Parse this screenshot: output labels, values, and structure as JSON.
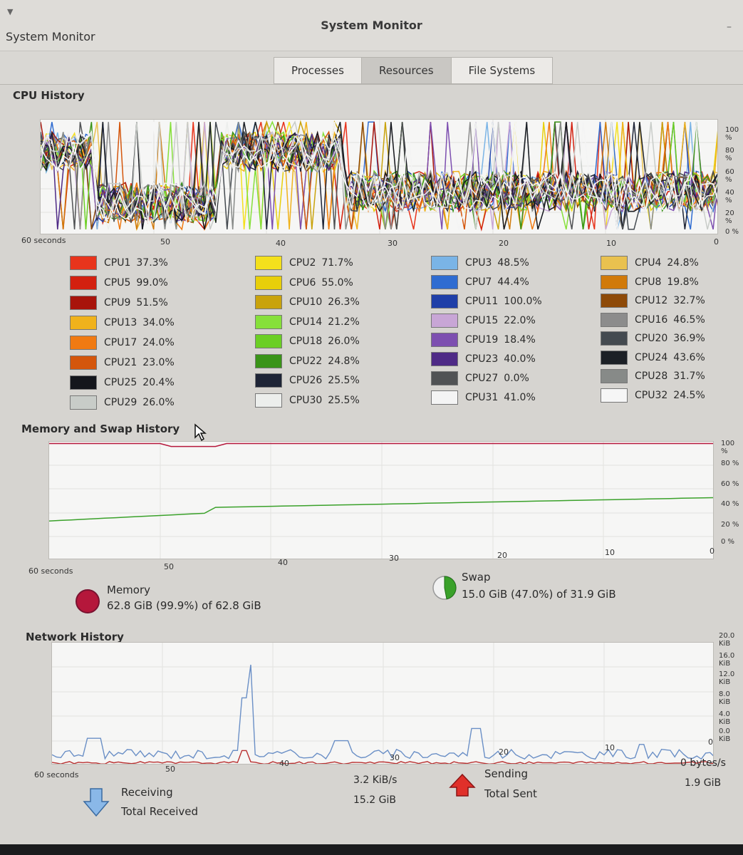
{
  "window": {
    "app_label": "System Monitor",
    "title": "System Monitor"
  },
  "tabs": [
    {
      "label": "Processes",
      "active": false
    },
    {
      "label": "Resources",
      "active": true
    },
    {
      "label": "File Systems",
      "active": false
    }
  ],
  "cpu": {
    "title": "CPU History",
    "y_ticks": [
      "100 %",
      "80 %",
      "60 %",
      "40 %",
      "20 %",
      "0 %"
    ],
    "x_ticks": [
      "60 seconds",
      "50",
      "40",
      "30",
      "20",
      "10",
      "0"
    ],
    "cores": [
      {
        "label": "CPU1",
        "value": "37.3%",
        "color": "#e8341c"
      },
      {
        "label": "CPU2",
        "value": "71.7%",
        "color": "#f4e01c"
      },
      {
        "label": "CPU3",
        "value": "48.5%",
        "color": "#7ab4e6"
      },
      {
        "label": "CPU4",
        "value": "24.8%",
        "color": "#e9c14f"
      },
      {
        "label": "CPU5",
        "value": "99.0%",
        "color": "#d3200f"
      },
      {
        "label": "CPU6",
        "value": "55.0%",
        "color": "#e8cf0a"
      },
      {
        "label": "CPU7",
        "value": "44.4%",
        "color": "#2f6cd1"
      },
      {
        "label": "CPU8",
        "value": "19.8%",
        "color": "#d17a0a"
      },
      {
        "label": "CPU9",
        "value": "51.5%",
        "color": "#a8140b"
      },
      {
        "label": "CPU10",
        "value": "26.3%",
        "color": "#c9a30c"
      },
      {
        "label": "CPU11",
        "value": "100.0%",
        "color": "#1f3fa8"
      },
      {
        "label": "CPU12",
        "value": "32.7%",
        "color": "#8e4a08"
      },
      {
        "label": "CPU13",
        "value": "34.0%",
        "color": "#f0b21c"
      },
      {
        "label": "CPU14",
        "value": "21.2%",
        "color": "#86e03a"
      },
      {
        "label": "CPU15",
        "value": "22.0%",
        "color": "#c8a6d6"
      },
      {
        "label": "CPU16",
        "value": "46.5%",
        "color": "#8c8c8c"
      },
      {
        "label": "CPU17",
        "value": "24.0%",
        "color": "#f07a12"
      },
      {
        "label": "CPU18",
        "value": "26.0%",
        "color": "#6bcf24"
      },
      {
        "label": "CPU19",
        "value": "18.4%",
        "color": "#7d4fb0"
      },
      {
        "label": "CPU20",
        "value": "36.9%",
        "color": "#444a50"
      },
      {
        "label": "CPU21",
        "value": "23.0%",
        "color": "#d4560c"
      },
      {
        "label": "CPU22",
        "value": "24.8%",
        "color": "#3a9418"
      },
      {
        "label": "CPU23",
        "value": "40.0%",
        "color": "#4e2a86"
      },
      {
        "label": "CPU24",
        "value": "43.6%",
        "color": "#1c2026"
      },
      {
        "label": "CPU25",
        "value": "20.4%",
        "color": "#14161c"
      },
      {
        "label": "CPU26",
        "value": "25.5%",
        "color": "#1e2436"
      },
      {
        "label": "CPU27",
        "value": "0.0%",
        "color": "#505254"
      },
      {
        "label": "CPU28",
        "value": "31.7%",
        "color": "#878a88"
      },
      {
        "label": "CPU29",
        "value": "26.0%",
        "color": "#c8ccc8"
      },
      {
        "label": "CPU30",
        "value": "25.5%",
        "color": "#eceeec"
      },
      {
        "label": "CPU31",
        "value": "41.0%",
        "color": "#f4f4f4"
      },
      {
        "label": "CPU32",
        "value": "24.5%",
        "color": "#f6f6f6"
      }
    ]
  },
  "memory": {
    "title": "Memory and Swap History",
    "y_ticks": [
      "100 %",
      "80 %",
      "60 %",
      "40 %",
      "20 %",
      "0 %"
    ],
    "x_ticks": [
      "60 seconds",
      "50",
      "40",
      "30",
      "20",
      "10",
      "0"
    ],
    "memory_label": "Memory",
    "memory_value": "62.8 GiB (99.9%) of 62.8 GiB",
    "memory_color": "#b5173b",
    "memory_fraction": 0.999,
    "swap_label": "Swap",
    "swap_value": "15.0 GiB (47.0%) of 31.9 GiB",
    "swap_color": "#3aa12a",
    "swap_fraction": 0.47
  },
  "network": {
    "title": "Network History",
    "y_ticks": [
      "20.0 KiB",
      "16.0 KiB",
      "12.0 KiB",
      "8.0 KiB",
      "4.0 KiB",
      "0.0 KiB"
    ],
    "x_ticks": [
      "60 seconds",
      "50",
      "40",
      "30",
      "20",
      "10",
      "0"
    ],
    "receiving_label": "Receiving",
    "receiving_rate": "3.2 KiB/s",
    "total_received_label": "Total Received",
    "total_received": "15.2 GiB",
    "sending_label": "Sending",
    "sending_rate": "0 bytes/s",
    "total_sent_label": "Total Sent",
    "total_sent": "1.9 GiB",
    "receiving_color": "#6a8fc6",
    "sending_color": "#b83030"
  }
}
